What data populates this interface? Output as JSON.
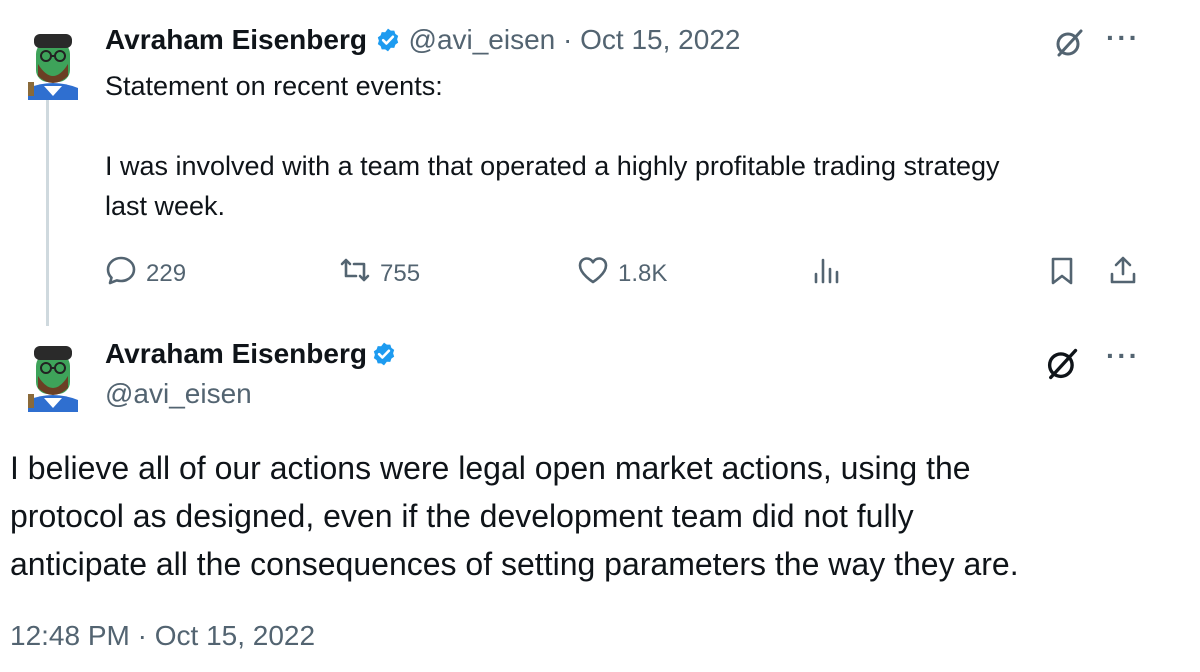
{
  "tweet1": {
    "author_name": "Avraham Eisenberg",
    "handle": "@avi_eisen",
    "separator": "·",
    "date": "Oct 15, 2022",
    "text_line1": "Statement on recent events:",
    "text_line2": "I was involved with a team that operated a highly profitable trading strategy",
    "text_line3": "last week.",
    "replies": "229",
    "reposts": "755",
    "likes": "1.8K"
  },
  "tweet2": {
    "author_name": "Avraham Eisenberg",
    "handle": "@avi_eisen",
    "text_line1": "I believe all of our actions were legal open market actions, using the",
    "text_line2": "protocol as designed, even if the development team did not fully",
    "text_line3": "anticipate all the consequences of setting parameters the way they are.",
    "timestamp": "12:48 PM · Oct 15, 2022"
  },
  "icons": {
    "verified": "verified-badge-icon",
    "grok": "grok-icon",
    "more": "more-icon",
    "reply": "reply-icon",
    "repost": "repost-icon",
    "like": "like-icon",
    "views": "views-icon",
    "bookmark": "bookmark-icon",
    "share": "share-icon"
  },
  "colors": {
    "verified_blue": "#1d9bf0",
    "muted": "#536471",
    "text": "#0f1419",
    "thread_line": "#cfd9de"
  }
}
